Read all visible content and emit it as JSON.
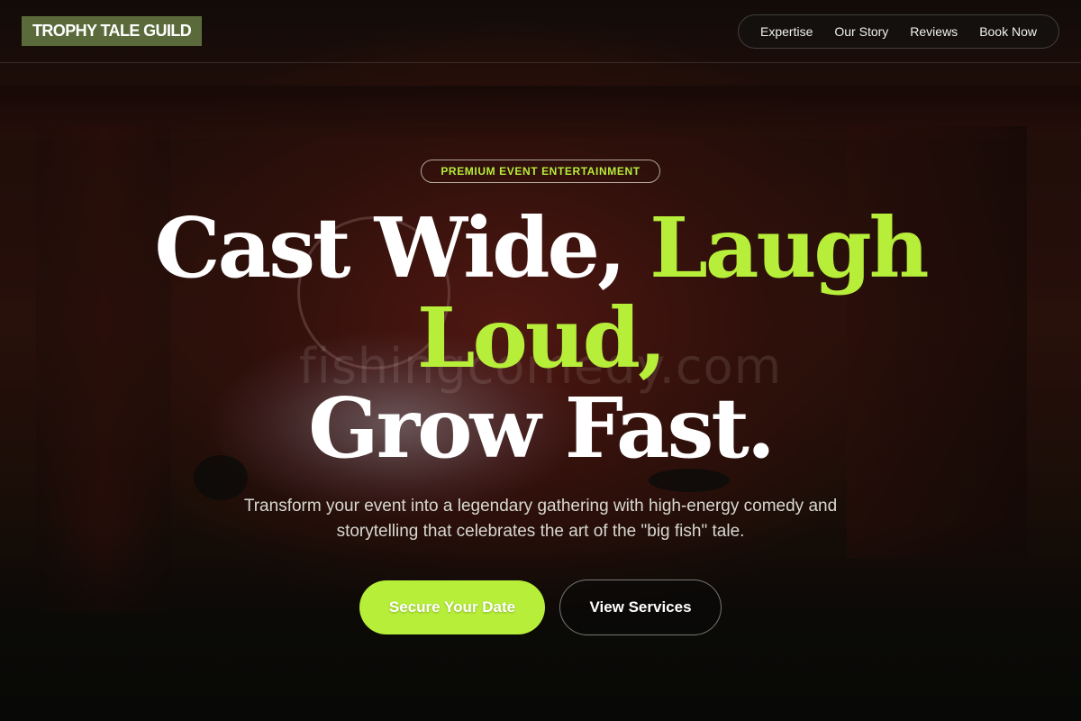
{
  "header": {
    "logo_text": "TROPHY TALE GUILD",
    "nav": [
      {
        "label": "Expertise"
      },
      {
        "label": "Our Story"
      },
      {
        "label": "Reviews"
      },
      {
        "label": "Book Now"
      }
    ]
  },
  "hero": {
    "eyebrow": "PREMIUM EVENT ENTERTAINMENT",
    "headline": {
      "part1": "Cast Wide, ",
      "part2": "Laugh",
      "part3": "Loud,",
      "part4": "Grow Fast."
    },
    "subcopy": "Transform your event into a legendary gathering with high-energy comedy and storytelling that celebrates the art of the \"big fish\" tale.",
    "primary_cta": "Secure Your Date",
    "secondary_cta": "View Services",
    "background_watermark": "fishingcomedy.com"
  },
  "colors": {
    "accent": "#b6ee3a",
    "logo_bg": "#5a6a3a",
    "text": "#ffffff"
  }
}
